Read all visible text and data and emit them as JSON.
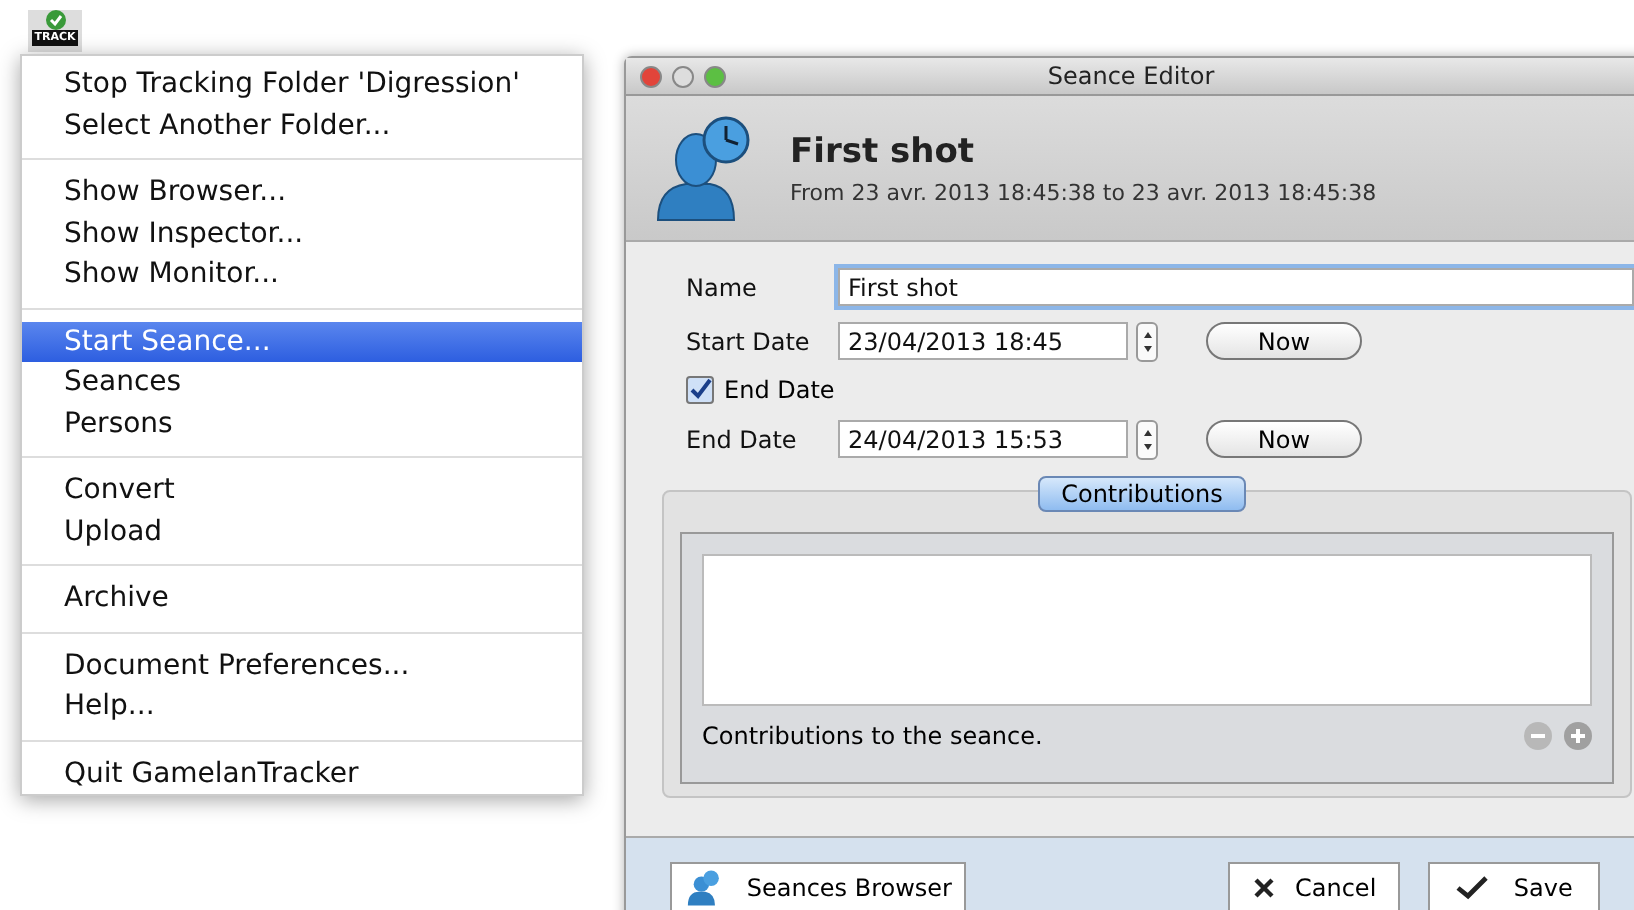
{
  "menubar_icon": {
    "label": "TRACK"
  },
  "menu": {
    "groups": [
      {
        "items": [
          {
            "label": "Stop Tracking Folder 'Digression'",
            "selected": false
          },
          {
            "label": "Select Another Folder...",
            "selected": false
          }
        ]
      },
      {
        "items": [
          {
            "label": "Show Browser...",
            "selected": false
          },
          {
            "label": "Show Inspector...",
            "selected": false
          },
          {
            "label": "Show Monitor...",
            "selected": false
          }
        ]
      },
      {
        "items": [
          {
            "label": "Start Seance...",
            "selected": true
          },
          {
            "label": "Seances",
            "selected": false
          },
          {
            "label": "Persons",
            "selected": false
          }
        ]
      },
      {
        "items": [
          {
            "label": "Convert",
            "selected": false
          },
          {
            "label": "Upload",
            "selected": false
          }
        ]
      },
      {
        "items": [
          {
            "label": "Archive",
            "selected": false
          }
        ]
      },
      {
        "items": [
          {
            "label": "Document Preferences...",
            "selected": false
          },
          {
            "label": "Help...",
            "selected": false
          }
        ]
      },
      {
        "items": [
          {
            "label": "Quit GamelanTracker",
            "selected": false
          }
        ]
      }
    ]
  },
  "window": {
    "title": "Seance Editor",
    "header": {
      "title": "First shot",
      "subtitle": "From 23 avr. 2013 18:45:38 to 23 avr. 2013 18:45:38"
    },
    "name_field": {
      "label": "Name",
      "value": "First shot"
    },
    "start_date": {
      "label": "Start Date",
      "value": "23/04/2013 18:45",
      "button": "Now"
    },
    "end_date_checkbox": {
      "label": "End Date",
      "checked": true
    },
    "end_date": {
      "label": "End Date",
      "value": "24/04/2013 15:53",
      "button": "Now"
    },
    "contributions": {
      "tab": {
        "label": "Contributions",
        "selected": true
      },
      "caption": "Contributions to the seance."
    },
    "footer": {
      "browser_button": "Seances Browser",
      "cancel_button": "Cancel",
      "save_button": "Save"
    }
  }
}
